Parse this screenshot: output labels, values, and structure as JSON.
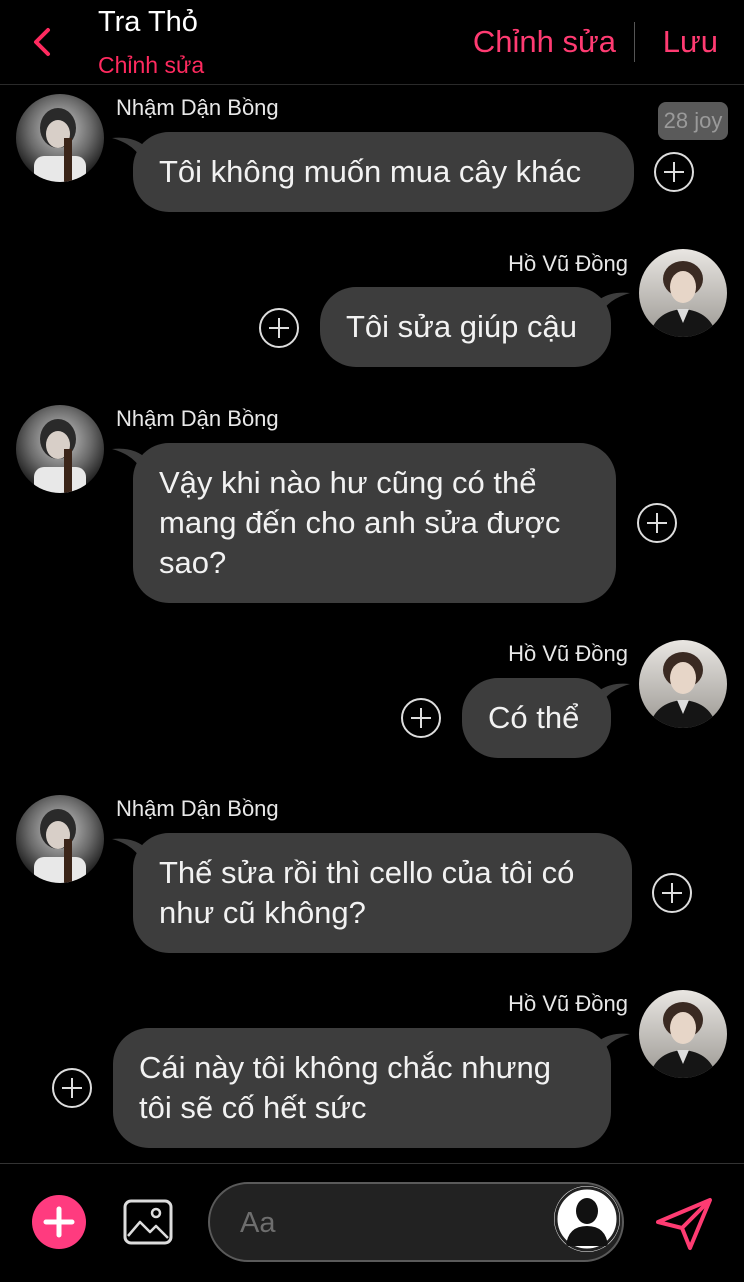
{
  "header": {
    "title": "Tra Thỏ",
    "subtitle": "Chỉnh sửa",
    "edit_label": "Chỉnh sửa",
    "save_label": "Lưu"
  },
  "badge": "28 joy",
  "messages": [
    {
      "sender": "Nhậm Dận Bồng",
      "side": "left",
      "text": "Tôi không muốn mua cây khác"
    },
    {
      "sender": "Hồ Vũ Đồng",
      "side": "right",
      "text": "Tôi sửa giúp cậu"
    },
    {
      "sender": "Nhậm Dận Bồng",
      "side": "left",
      "text": "Vậy khi nào hư cũng có thể mang đến cho anh sửa được sao?"
    },
    {
      "sender": "Hồ Vũ Đồng",
      "side": "right",
      "text": "Có thể"
    },
    {
      "sender": "Nhậm Dận Bồng",
      "side": "left",
      "text": "Thế sửa rồi thì cello của tôi có như cũ không?"
    },
    {
      "sender": "Hồ Vũ Đồng",
      "side": "right",
      "text": "Cái này tôi không chắc nhưng tôi sẽ cố hết sức"
    }
  ],
  "composer": {
    "placeholder": "Aa"
  },
  "colors": {
    "accent": "#ff3b72",
    "bubble": "#3d3d3d",
    "background": "#000000"
  },
  "icons": [
    "chevron-left-icon",
    "add-reaction-icon",
    "plus-icon",
    "image-icon",
    "user-silhouette-icon",
    "send-icon"
  ]
}
